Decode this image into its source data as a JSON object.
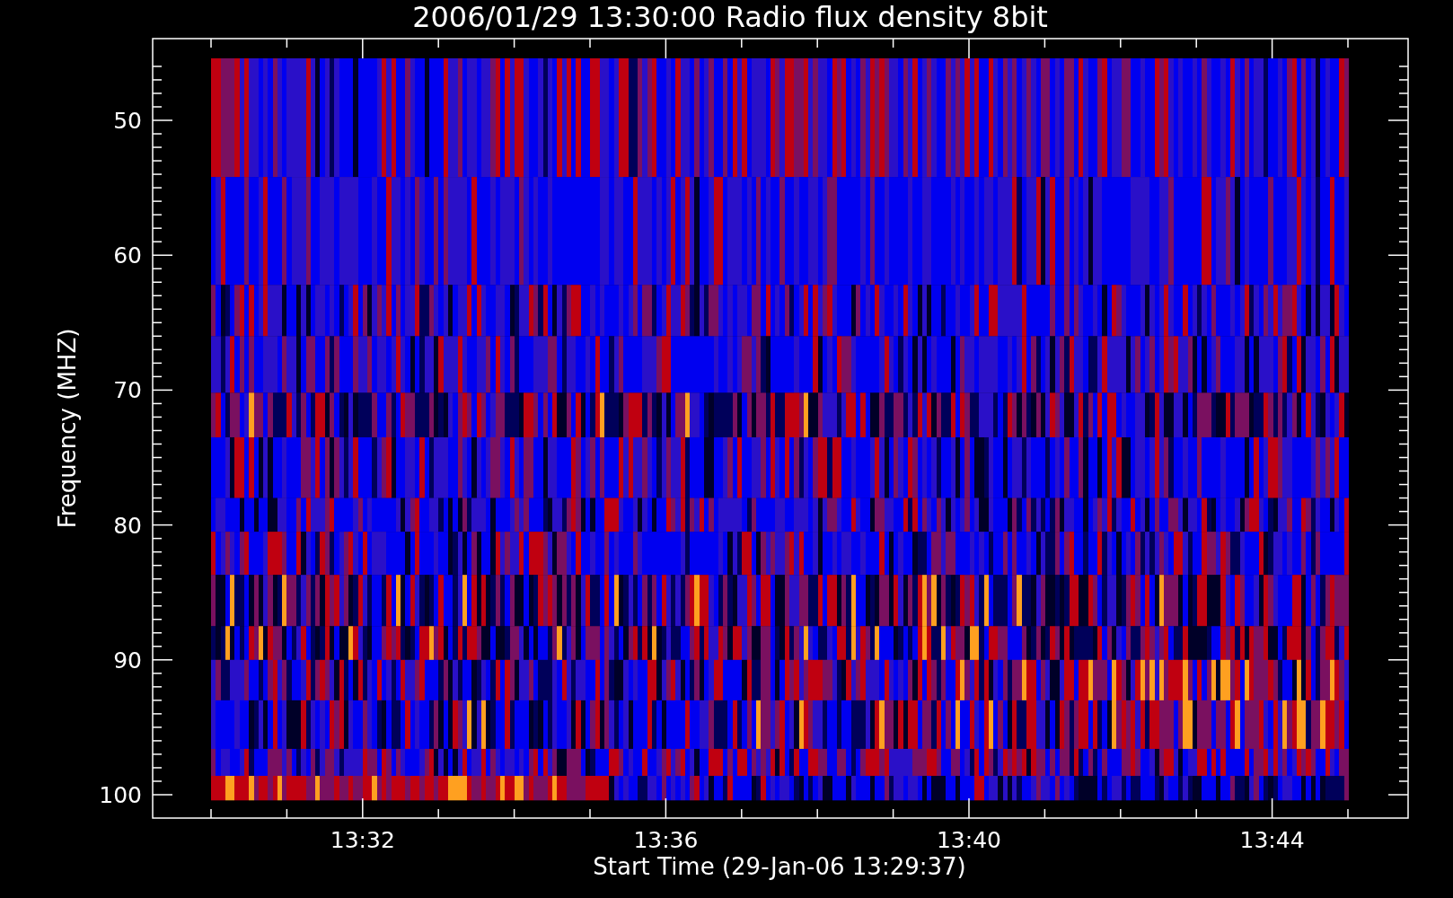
{
  "title": "2006/01/29 13:30:00 Radio flux density 8bit",
  "y_axis": {
    "label": "Frequency (MHZ)",
    "ticks": [
      "50",
      "60",
      "70",
      "80",
      "90",
      "100"
    ]
  },
  "x_axis": {
    "label": "Start Time (29-Jan-06 13:29:37)",
    "ticks": [
      "13:32",
      "13:36",
      "13:40",
      "13:44"
    ]
  }
}
